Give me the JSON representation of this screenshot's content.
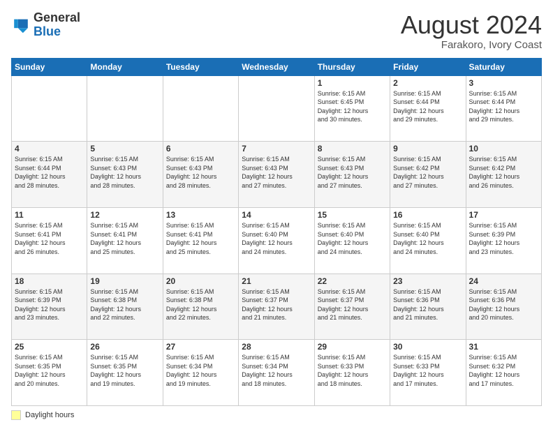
{
  "header": {
    "logo": {
      "line1": "General",
      "line2": "Blue"
    },
    "month_title": "August 2024",
    "location": "Farakoro, Ivory Coast"
  },
  "weekdays": [
    "Sunday",
    "Monday",
    "Tuesday",
    "Wednesday",
    "Thursday",
    "Friday",
    "Saturday"
  ],
  "weeks": [
    [
      {
        "day": "",
        "info": ""
      },
      {
        "day": "",
        "info": ""
      },
      {
        "day": "",
        "info": ""
      },
      {
        "day": "",
        "info": ""
      },
      {
        "day": "1",
        "info": "Sunrise: 6:15 AM\nSunset: 6:45 PM\nDaylight: 12 hours\nand 30 minutes."
      },
      {
        "day": "2",
        "info": "Sunrise: 6:15 AM\nSunset: 6:44 PM\nDaylight: 12 hours\nand 29 minutes."
      },
      {
        "day": "3",
        "info": "Sunrise: 6:15 AM\nSunset: 6:44 PM\nDaylight: 12 hours\nand 29 minutes."
      }
    ],
    [
      {
        "day": "4",
        "info": "Sunrise: 6:15 AM\nSunset: 6:44 PM\nDaylight: 12 hours\nand 28 minutes."
      },
      {
        "day": "5",
        "info": "Sunrise: 6:15 AM\nSunset: 6:43 PM\nDaylight: 12 hours\nand 28 minutes."
      },
      {
        "day": "6",
        "info": "Sunrise: 6:15 AM\nSunset: 6:43 PM\nDaylight: 12 hours\nand 28 minutes."
      },
      {
        "day": "7",
        "info": "Sunrise: 6:15 AM\nSunset: 6:43 PM\nDaylight: 12 hours\nand 27 minutes."
      },
      {
        "day": "8",
        "info": "Sunrise: 6:15 AM\nSunset: 6:43 PM\nDaylight: 12 hours\nand 27 minutes."
      },
      {
        "day": "9",
        "info": "Sunrise: 6:15 AM\nSunset: 6:42 PM\nDaylight: 12 hours\nand 27 minutes."
      },
      {
        "day": "10",
        "info": "Sunrise: 6:15 AM\nSunset: 6:42 PM\nDaylight: 12 hours\nand 26 minutes."
      }
    ],
    [
      {
        "day": "11",
        "info": "Sunrise: 6:15 AM\nSunset: 6:41 PM\nDaylight: 12 hours\nand 26 minutes."
      },
      {
        "day": "12",
        "info": "Sunrise: 6:15 AM\nSunset: 6:41 PM\nDaylight: 12 hours\nand 25 minutes."
      },
      {
        "day": "13",
        "info": "Sunrise: 6:15 AM\nSunset: 6:41 PM\nDaylight: 12 hours\nand 25 minutes."
      },
      {
        "day": "14",
        "info": "Sunrise: 6:15 AM\nSunset: 6:40 PM\nDaylight: 12 hours\nand 24 minutes."
      },
      {
        "day": "15",
        "info": "Sunrise: 6:15 AM\nSunset: 6:40 PM\nDaylight: 12 hours\nand 24 minutes."
      },
      {
        "day": "16",
        "info": "Sunrise: 6:15 AM\nSunset: 6:40 PM\nDaylight: 12 hours\nand 24 minutes."
      },
      {
        "day": "17",
        "info": "Sunrise: 6:15 AM\nSunset: 6:39 PM\nDaylight: 12 hours\nand 23 minutes."
      }
    ],
    [
      {
        "day": "18",
        "info": "Sunrise: 6:15 AM\nSunset: 6:39 PM\nDaylight: 12 hours\nand 23 minutes."
      },
      {
        "day": "19",
        "info": "Sunrise: 6:15 AM\nSunset: 6:38 PM\nDaylight: 12 hours\nand 22 minutes."
      },
      {
        "day": "20",
        "info": "Sunrise: 6:15 AM\nSunset: 6:38 PM\nDaylight: 12 hours\nand 22 minutes."
      },
      {
        "day": "21",
        "info": "Sunrise: 6:15 AM\nSunset: 6:37 PM\nDaylight: 12 hours\nand 21 minutes."
      },
      {
        "day": "22",
        "info": "Sunrise: 6:15 AM\nSunset: 6:37 PM\nDaylight: 12 hours\nand 21 minutes."
      },
      {
        "day": "23",
        "info": "Sunrise: 6:15 AM\nSunset: 6:36 PM\nDaylight: 12 hours\nand 21 minutes."
      },
      {
        "day": "24",
        "info": "Sunrise: 6:15 AM\nSunset: 6:36 PM\nDaylight: 12 hours\nand 20 minutes."
      }
    ],
    [
      {
        "day": "25",
        "info": "Sunrise: 6:15 AM\nSunset: 6:35 PM\nDaylight: 12 hours\nand 20 minutes."
      },
      {
        "day": "26",
        "info": "Sunrise: 6:15 AM\nSunset: 6:35 PM\nDaylight: 12 hours\nand 19 minutes."
      },
      {
        "day": "27",
        "info": "Sunrise: 6:15 AM\nSunset: 6:34 PM\nDaylight: 12 hours\nand 19 minutes."
      },
      {
        "day": "28",
        "info": "Sunrise: 6:15 AM\nSunset: 6:34 PM\nDaylight: 12 hours\nand 18 minutes."
      },
      {
        "day": "29",
        "info": "Sunrise: 6:15 AM\nSunset: 6:33 PM\nDaylight: 12 hours\nand 18 minutes."
      },
      {
        "day": "30",
        "info": "Sunrise: 6:15 AM\nSunset: 6:33 PM\nDaylight: 12 hours\nand 17 minutes."
      },
      {
        "day": "31",
        "info": "Sunrise: 6:15 AM\nSunset: 6:32 PM\nDaylight: 12 hours\nand 17 minutes."
      }
    ]
  ],
  "footer": {
    "legend_label": "Daylight hours"
  }
}
